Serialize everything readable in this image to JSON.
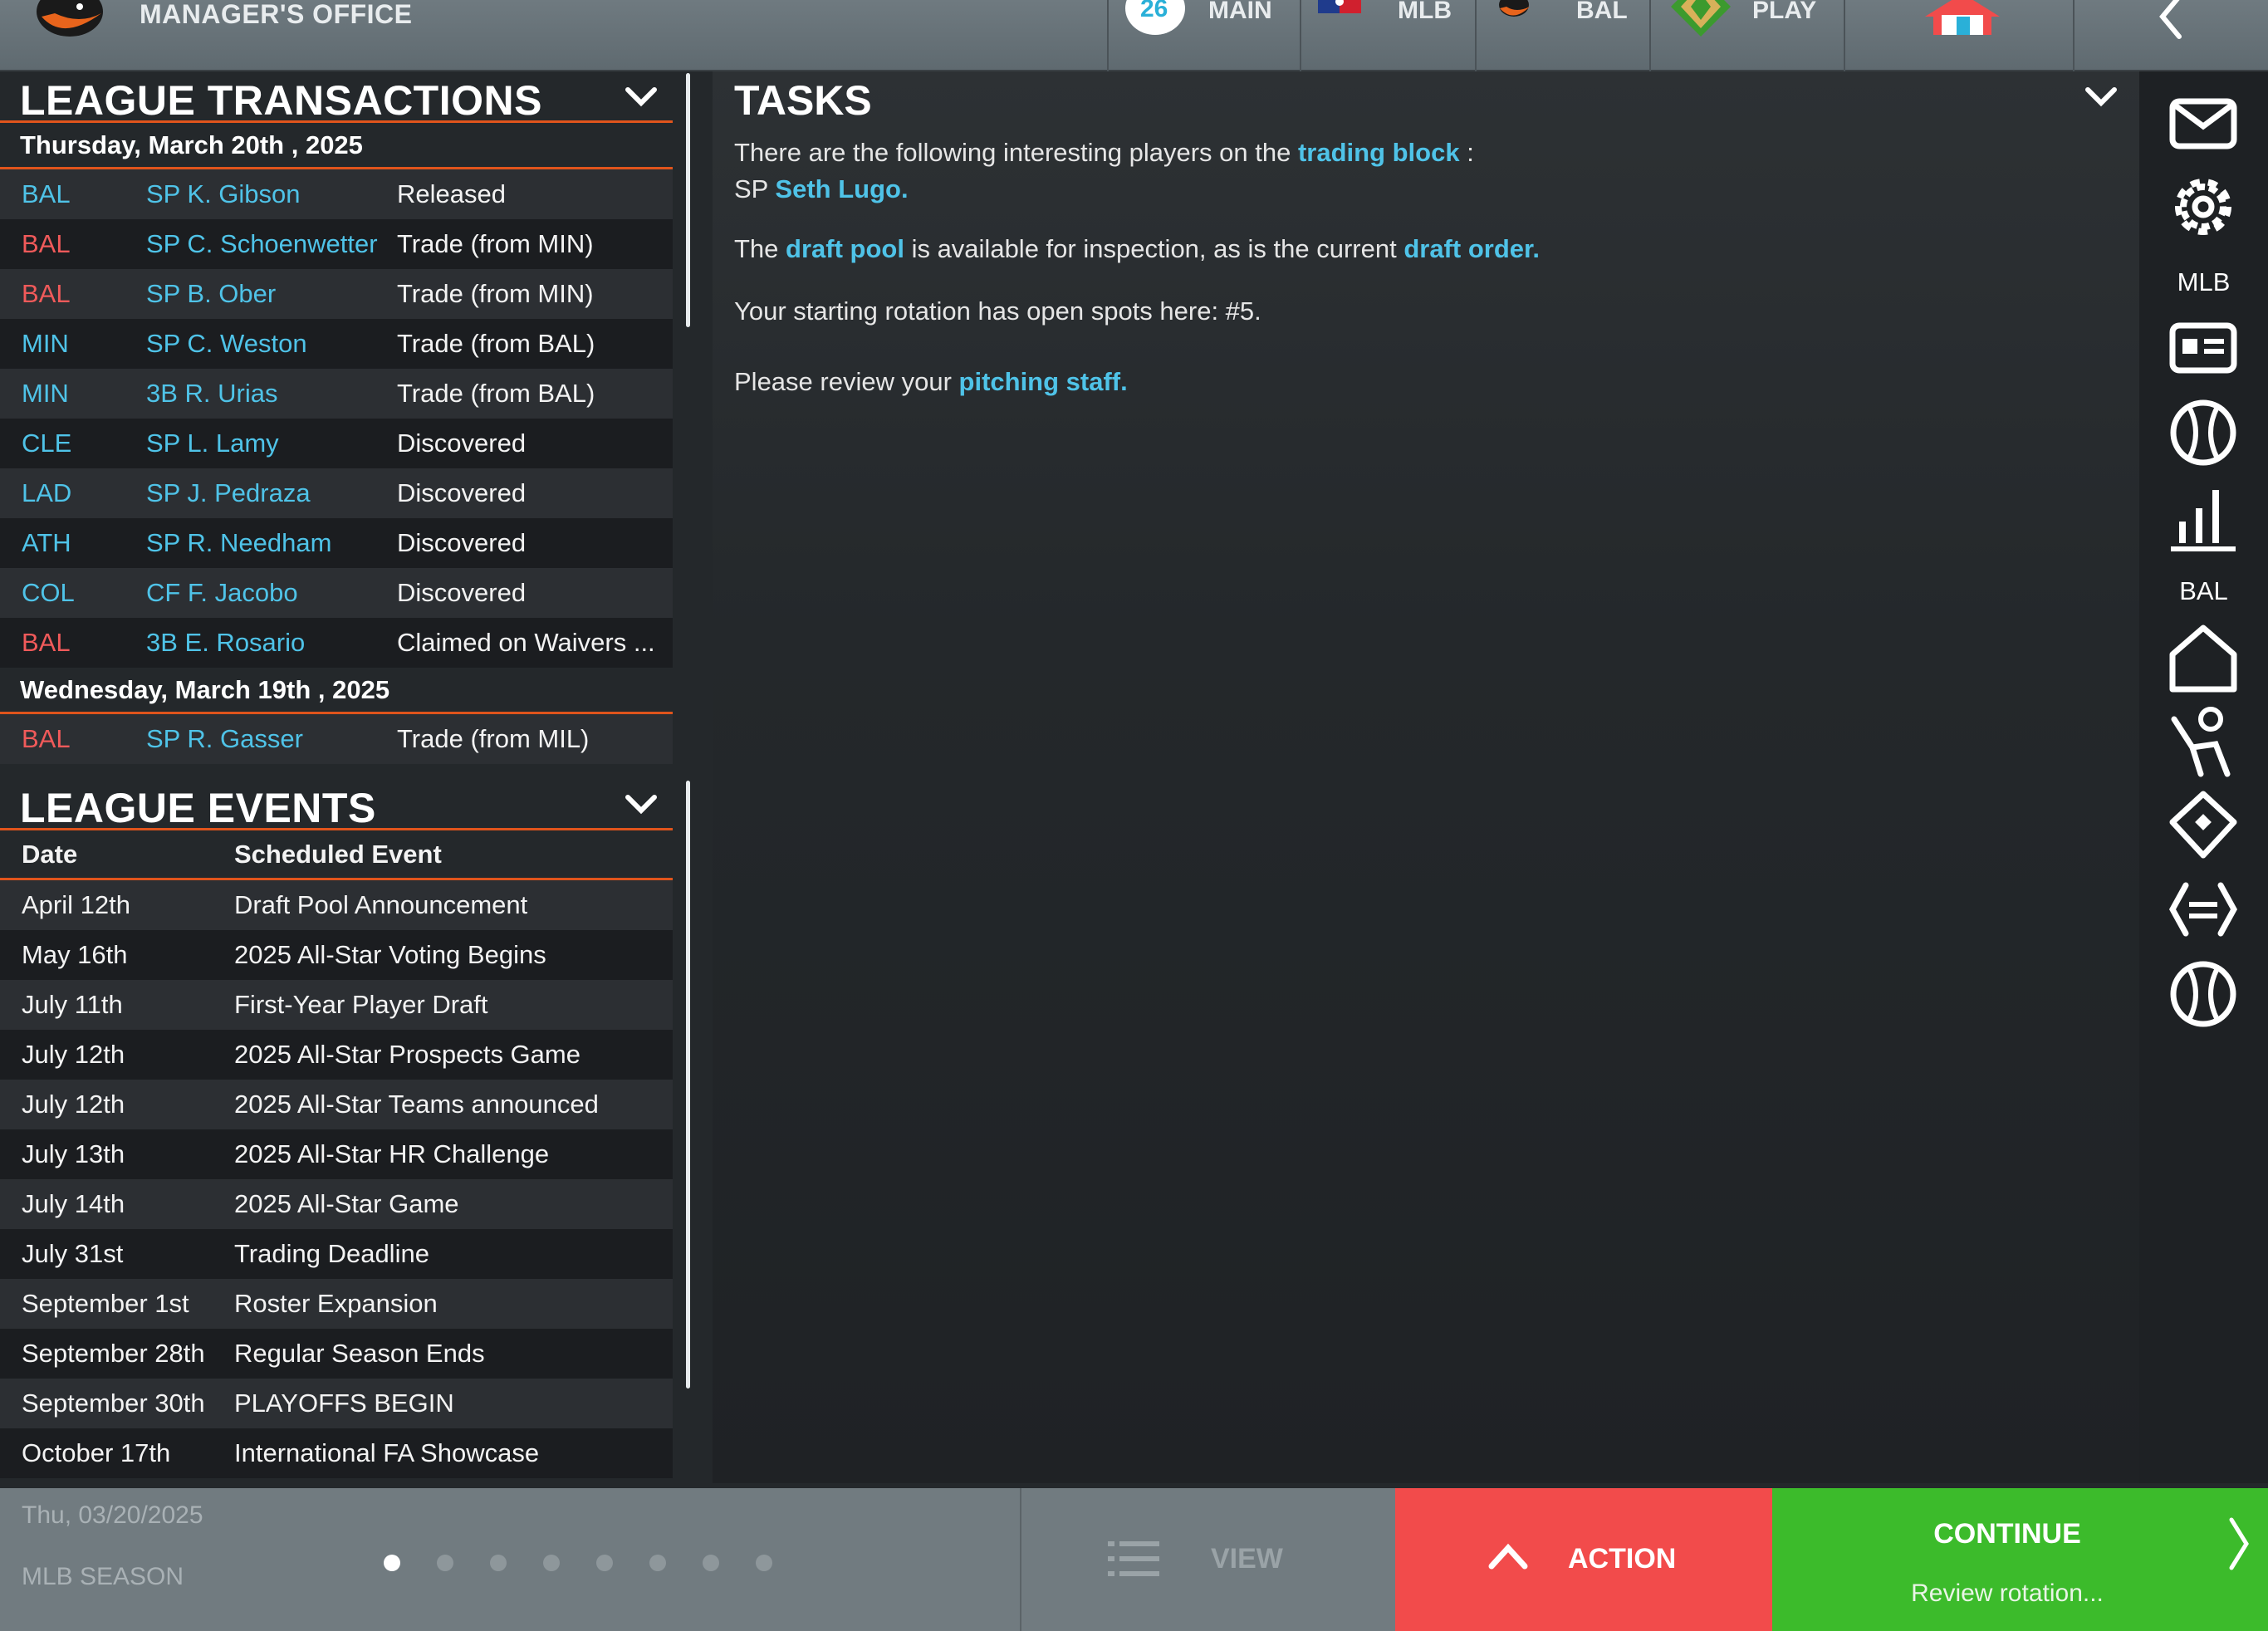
{
  "header": {
    "app_title": "MANAGER'S OFFICE",
    "tabs": [
      {
        "label": "MAIN",
        "icon": "mlb-26-icon"
      },
      {
        "label": "MLB",
        "icon": "mlb-logo-icon"
      },
      {
        "label": "BAL",
        "icon": "orioles-bird-icon"
      },
      {
        "label": "PLAY",
        "icon": "diamond-icon"
      }
    ],
    "home_icon": "home-icon",
    "back_icon": "back-arrow-icon"
  },
  "transactions": {
    "title": "LEAGUE TRANSACTIONS",
    "groups": [
      {
        "date": "Thursday, March 20th , 2025",
        "rows": [
          {
            "team": "BAL",
            "team_color": "blue",
            "player": "SP K. Gibson",
            "type": "Released"
          },
          {
            "team": "BAL",
            "team_color": "red",
            "player": "SP C. Schoenwetter",
            "type": "Trade (from MIN)"
          },
          {
            "team": "BAL",
            "team_color": "red",
            "player": "SP B. Ober",
            "type": "Trade (from MIN)"
          },
          {
            "team": "MIN",
            "team_color": "blue",
            "player": "SP C. Weston",
            "type": "Trade (from BAL)"
          },
          {
            "team": "MIN",
            "team_color": "blue",
            "player": "3B R. Urias",
            "type": "Trade (from BAL)"
          },
          {
            "team": "CLE",
            "team_color": "blue",
            "player": "SP L. Lamy",
            "type": "Discovered"
          },
          {
            "team": "LAD",
            "team_color": "blue",
            "player": "SP J. Pedraza",
            "type": "Discovered"
          },
          {
            "team": "ATH",
            "team_color": "blue",
            "player": "SP R. Needham",
            "type": "Discovered"
          },
          {
            "team": "COL",
            "team_color": "blue",
            "player": "CF F. Jacobo",
            "type": "Discovered"
          },
          {
            "team": "BAL",
            "team_color": "red",
            "player": "3B E. Rosario",
            "type": "Claimed on Waivers ..."
          }
        ]
      },
      {
        "date": "Wednesday, March 19th , 2025",
        "rows": [
          {
            "team": "BAL",
            "team_color": "red",
            "player": "SP R. Gasser",
            "type": "Trade (from MIL)"
          }
        ]
      }
    ]
  },
  "events": {
    "title": "LEAGUE EVENTS",
    "col_date": "Date",
    "col_event": "Scheduled Event",
    "rows": [
      {
        "date": "April 12th",
        "event": "Draft Pool Announcement"
      },
      {
        "date": "May 16th",
        "event": "2025 All-Star Voting Begins"
      },
      {
        "date": "July 11th",
        "event": "First-Year Player Draft"
      },
      {
        "date": "July 12th",
        "event": "2025 All-Star Prospects Game"
      },
      {
        "date": "July 12th",
        "event": "2025 All-Star Teams announced"
      },
      {
        "date": "July 13th",
        "event": "2025 All-Star HR Challenge"
      },
      {
        "date": "July 14th",
        "event": "2025 All-Star Game"
      },
      {
        "date": "July 31st",
        "event": "Trading Deadline"
      },
      {
        "date": "September 1st",
        "event": "Roster Expansion"
      },
      {
        "date": "September 28th",
        "event": "Regular Season Ends"
      },
      {
        "date": "September 30th",
        "event": "PLAYOFFS BEGIN"
      },
      {
        "date": "October 17th",
        "event": "International FA Showcase"
      }
    ]
  },
  "tasks": {
    "title": "TASKS",
    "line1_pre": "There are the following interesting players on the ",
    "line1_link": "trading block",
    "line1_post": " :",
    "line2_pre": "SP ",
    "line2_link": "Seth Lugo.",
    "line3_pre": "The ",
    "line3_link1": "draft pool",
    "line3_mid": " is available for inspection, as is the current ",
    "line3_link2": "draft order.",
    "line4": "Your starting rotation has open spots here: #5.",
    "line5_pre": "Please review your ",
    "line5_link": "pitching staff."
  },
  "sidebar": {
    "label_mlb": "MLB",
    "label_bal": "BAL",
    "icons": [
      "mail-icon",
      "gear-icon",
      "id-card-icon",
      "baseball-icon",
      "bar-chart-icon",
      "home-plate-icon",
      "pitcher-icon",
      "diamond-icon",
      "trade-arrows-icon",
      "baseball-icon"
    ]
  },
  "footer": {
    "date": "Thu, 03/20/2025",
    "season": "MLB SEASON",
    "page_count": 8,
    "active_page": 1,
    "view_label": "VIEW",
    "action_label": "ACTION",
    "continue_label": "CONTINUE",
    "continue_sub": "Review rotation..."
  },
  "colors": {
    "accent_orange": "#e0541c",
    "link_blue": "#4fc3e8",
    "team_red": "#f05a5a",
    "action_red": "#f24b4b",
    "continue_green": "#3cbb2b"
  }
}
